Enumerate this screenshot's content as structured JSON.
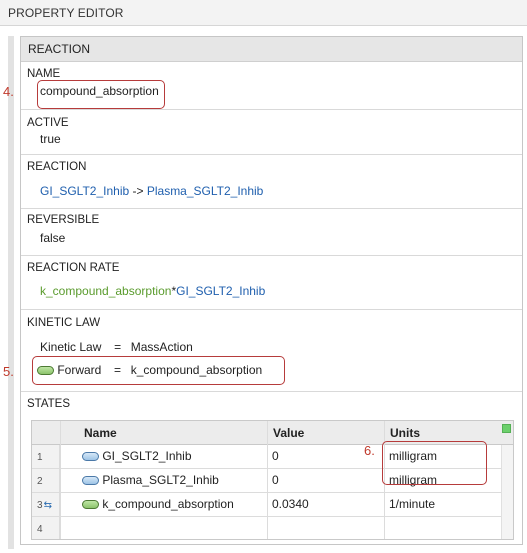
{
  "window": {
    "title": "PROPERTY EDITOR"
  },
  "panel": {
    "title": "REACTION"
  },
  "name_section": {
    "label": "NAME",
    "value": "compound_absorption",
    "annotation": "4."
  },
  "active_section": {
    "label": "ACTIVE",
    "value": "true"
  },
  "reaction_section": {
    "label": "REACTION",
    "reactant": "GI_SGLT2_Inhib",
    "arrow": " -> ",
    "product": "Plasma_SGLT2_Inhib"
  },
  "reversible_section": {
    "label": "REVERSIBLE",
    "value": "false"
  },
  "reaction_rate_section": {
    "label": "REACTION RATE",
    "param": "k_compound_absorption",
    "op": "*",
    "species": "GI_SGLT2_Inhib"
  },
  "kinetic_law_section": {
    "label": "KINETIC LAW",
    "law_label": "Kinetic Law",
    "law_eq": "=",
    "law_value": "MassAction",
    "forward_label": "Forward",
    "forward_eq": "=",
    "forward_value": "k_compound_absorption",
    "annotation": "5."
  },
  "states_section": {
    "label": "STATES",
    "columns": [
      "Name",
      "Value",
      "Units"
    ],
    "rows": [
      {
        "num": "1",
        "name": "GI_SGLT2_Inhib",
        "value": "0",
        "units": "milligram",
        "icon": "species-icon"
      },
      {
        "num": "2",
        "name": "Plasma_SGLT2_Inhib",
        "value": "0",
        "units": "milligram",
        "icon": "species-icon"
      },
      {
        "num": "3",
        "name": "k_compound_absorption",
        "value": "0.0340",
        "units": "1/minute",
        "icon": "parameter-icon"
      },
      {
        "num": "4",
        "name": "",
        "value": "",
        "units": "",
        "icon": ""
      }
    ],
    "annotation": "6."
  },
  "colors": {
    "species_blue": "#1f5fae",
    "parameter_green": "#5a9b2d",
    "annotation_red": "#c0392b"
  }
}
